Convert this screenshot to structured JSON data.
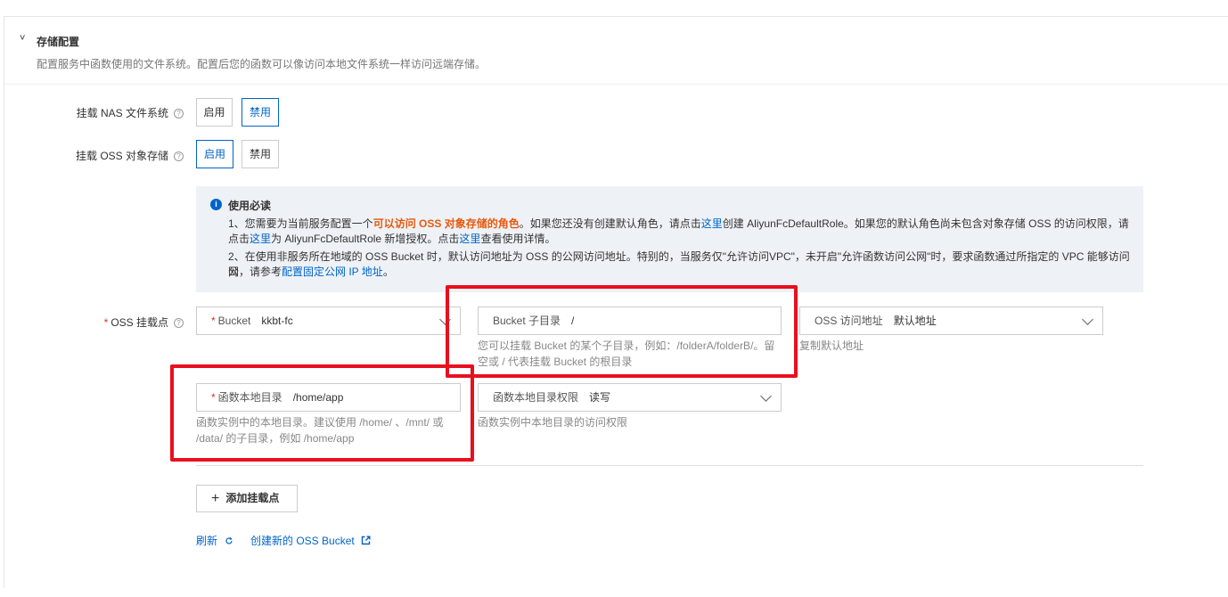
{
  "section": {
    "title": "存储配置",
    "description": "配置服务中函数使用的文件系统。配置后您的函数可以像访问本地文件系统一样访问远端存储。"
  },
  "nas": {
    "label": "挂载 NAS 文件系统",
    "enable": "启用",
    "disable": "禁用",
    "selected": "禁用"
  },
  "oss": {
    "label": "挂载 OSS 对象存储",
    "enable": "启用",
    "disable": "禁用",
    "selected": "启用"
  },
  "notice": {
    "title": "使用必读",
    "line1_a": "1、您需要为当前服务配置一个",
    "line1_highlight": "可以访问 OSS 对象存储的角色",
    "line1_b": "。如果您还没有创建默认角色，请点击",
    "line1_link1": "这里",
    "line1_c": "创建 AliyunFcDefaultRole。如果您的默认角色尚未包含对象存储 OSS 的访问权限，请",
    "line1_d": "点击",
    "line1_link2": "这里",
    "line1_e": "为 AliyunFcDefaultRole 新增授权。点击",
    "line1_link3": "这里",
    "line1_f": "查看使用详情。",
    "line2_a": "2、在使用非服务所在地域的 OSS Bucket 时，默认访问地址为 OSS 的公网访问地址。特别的，当服务仅\"允许访问VPC\"，未开启\"允许函数访问公网\"时，要求函数通过所指定的 VPC 能够访问公",
    "line2_b": "网，请参考",
    "line2_link": "配置固定公网 IP 地址",
    "line2_c": "。"
  },
  "mount": {
    "label": "OSS 挂载点",
    "bucket_key": "Bucket",
    "bucket_value": "kkbt-fc",
    "subdir_key": "Bucket 子目录",
    "subdir_value": "/",
    "subdir_hint1": "您可以挂载 Bucket 的某个子目录，例如：/folderA/folderB/。留",
    "subdir_hint2": "空或 / 代表挂载 Bucket 的根目录",
    "endpoint_key": "OSS 访问地址",
    "endpoint_value": "默认地址",
    "copy_link": "复制默认地址",
    "localdir_key": "函数本地目录",
    "localdir_value": "/home/app",
    "localdir_hint1": "函数实例中的本地目录。建议使用 /home/ 、/mnt/ 或",
    "localdir_hint2": "/data/ 的子目录，例如 /home/app",
    "perm_key": "函数本地目录权限",
    "perm_value": "读写",
    "perm_hint": "函数实例中本地目录的访问权限"
  },
  "actions": {
    "add": "添加挂载点",
    "refresh": "刷新",
    "create_bucket": "创建新的 OSS Bucket"
  },
  "colors": {
    "accent": "#0064c8",
    "highlight": "#e8590c",
    "annotation": "#e8101d"
  }
}
